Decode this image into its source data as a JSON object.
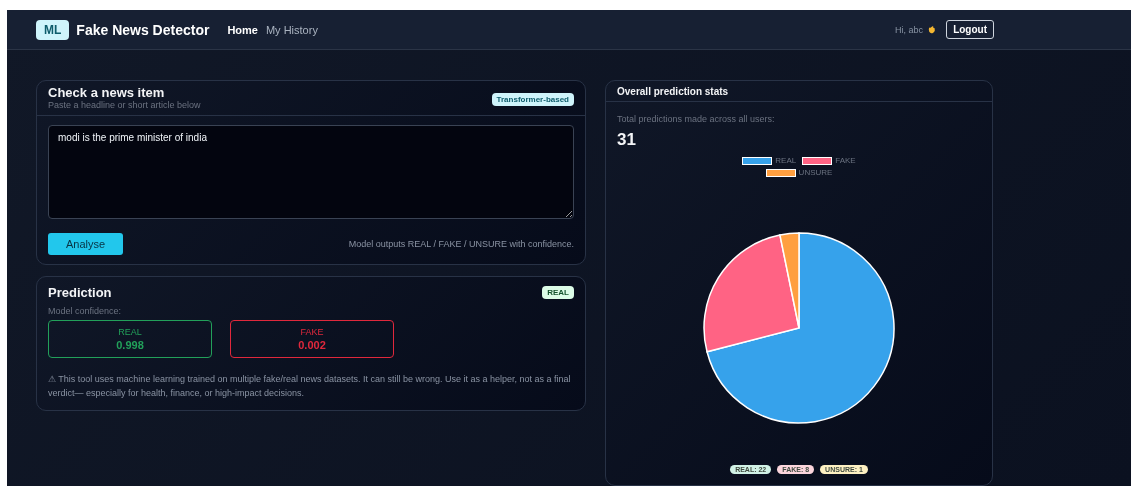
{
  "nav": {
    "logo": "ML",
    "title": "Fake News Detector",
    "links": [
      {
        "label": "Home",
        "selected": true
      },
      {
        "label": "My History",
        "selected": false
      }
    ],
    "greeting": "Hi, abc",
    "logout": "Logout"
  },
  "check": {
    "title": "Check a news item",
    "subtitle": "Paste a headline or short article below",
    "badge": "Transformer-based",
    "value": "modi is the prime minister of india",
    "button": "Analyse",
    "note": "Model outputs REAL / FAKE / UNSURE with confidence."
  },
  "prediction": {
    "title": "Prediction",
    "badge": "REAL",
    "confidence_label": "Model confidence:",
    "scores": [
      {
        "label": "REAL",
        "value": "0.998",
        "color": "#22a05a"
      },
      {
        "label": "FAKE",
        "value": "0.002",
        "color": "#e0283c"
      }
    ],
    "disclaimer": "⚠ This tool uses machine learning trained on multiple fake/real news datasets. It can still be wrong. Use it as a helper, not as a final verdict— especially for health, finance, or high-impact decisions."
  },
  "stats": {
    "title": "Overall prediction stats",
    "total_label": "Total predictions made across all users:",
    "total": "31",
    "legend": [
      {
        "color": "#36a2eb"
      },
      {
        "color": "#ff6384"
      },
      {
        "color": "#ff9f40"
      }
    ],
    "chart_data": {
      "type": "pie",
      "categories": [
        "REAL",
        "FAKE",
        "UNSURE"
      ],
      "values": [
        70.97,
        25.81,
        3.22
      ]
    },
    "counts": [
      {
        "label": "REAL: 22",
        "color": "#d1f2e6"
      },
      {
        "label": "FAKE: 8",
        "color": "#fbd5dc"
      },
      {
        "label": "UNSURE: 1",
        "color": "#fdf0c2"
      }
    ]
  }
}
